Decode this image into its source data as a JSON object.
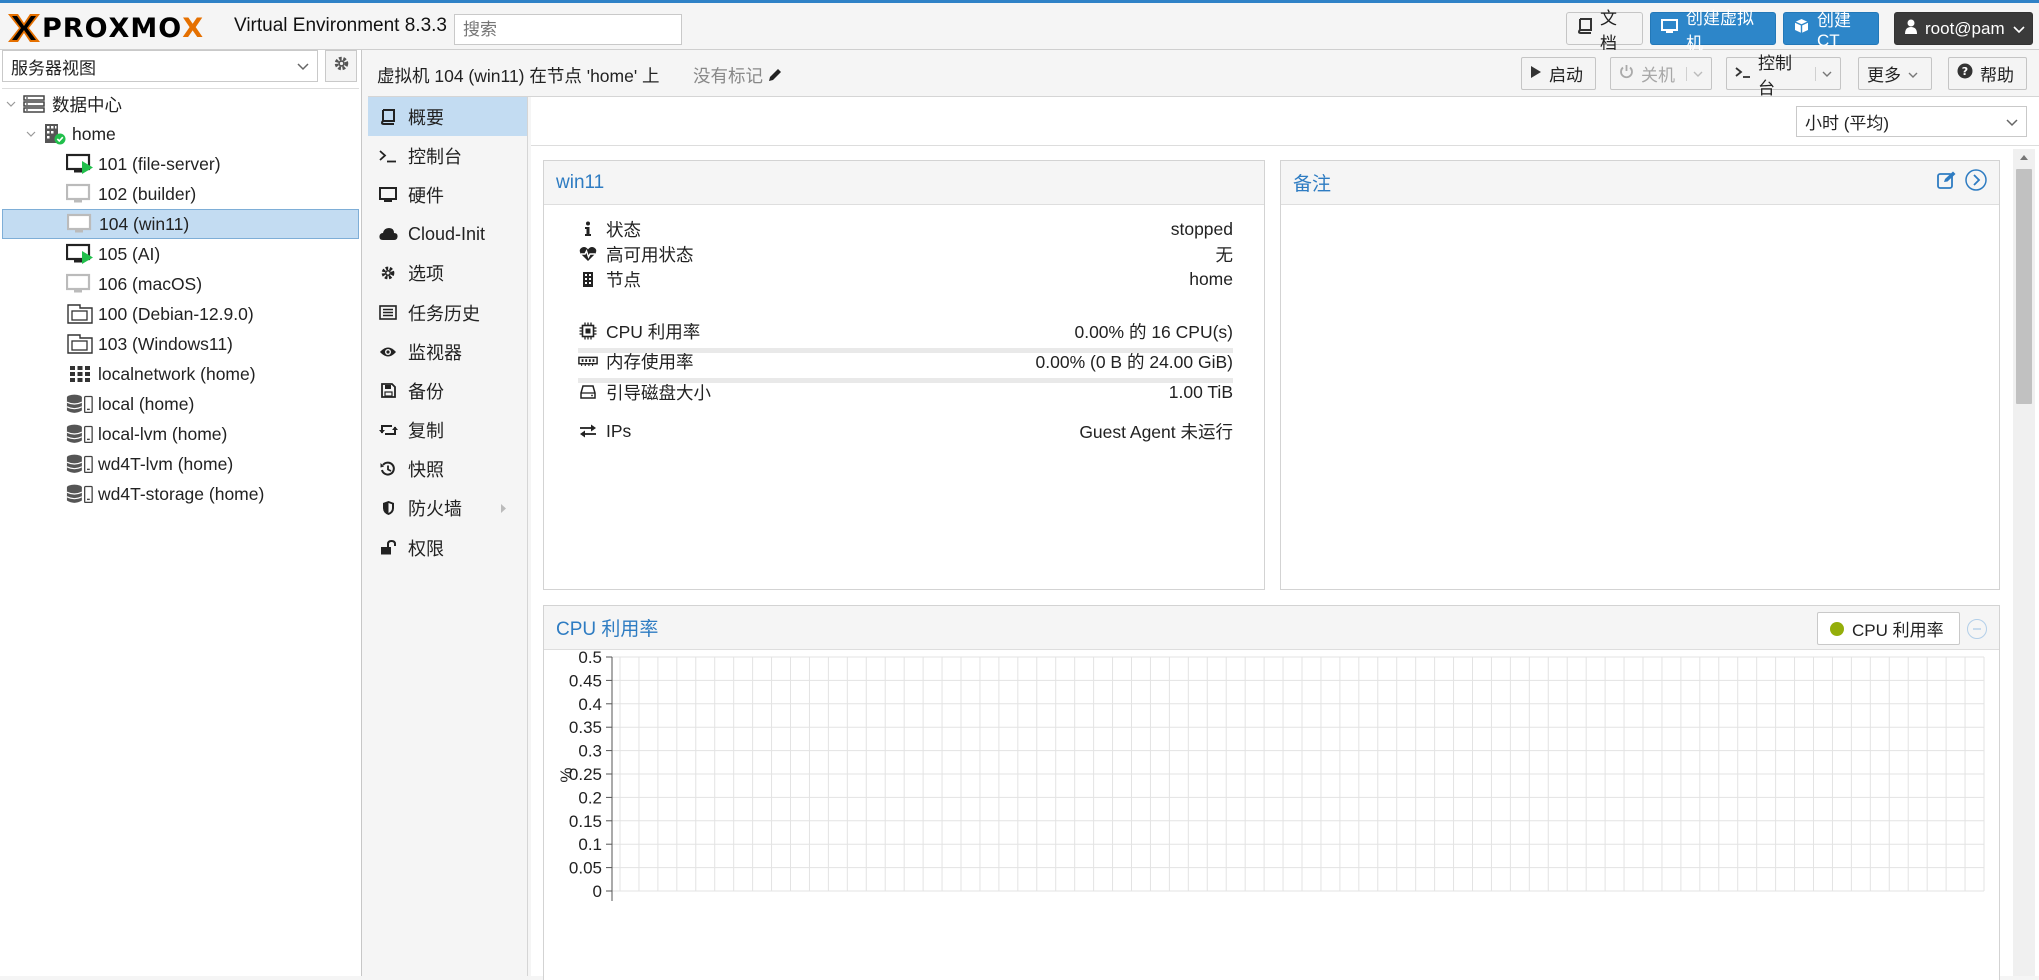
{
  "topbar": {
    "logo_text_left": "PRO",
    "logo_text_right": "MO",
    "logo_x": "X",
    "title": "Virtual Environment 8.3.3",
    "search_placeholder": "搜索",
    "docs_label": "文档",
    "create_vm_label": "创建虚拟机",
    "create_ct_label": "创建 CT",
    "user_label": "root@pam"
  },
  "sidebar": {
    "view_label": "服务器视图",
    "tree": [
      {
        "label": "数据中心",
        "icon": "datacenter-icon",
        "level": 0
      },
      {
        "label": "home",
        "icon": "node-online-icon",
        "level": 1
      },
      {
        "label": "101 (file-server)",
        "icon": "vm-running-icon",
        "level": 2
      },
      {
        "label": "102 (builder)",
        "icon": "vm-stopped-icon",
        "level": 2
      },
      {
        "label": "104 (win11)",
        "icon": "vm-stopped-icon",
        "level": 2,
        "selected": true
      },
      {
        "label": "105 (AI)",
        "icon": "vm-running-icon",
        "level": 2
      },
      {
        "label": "106 (macOS)",
        "icon": "vm-stopped-icon",
        "level": 2
      },
      {
        "label": "100 (Debian-12.9.0)",
        "icon": "vm-template-icon",
        "level": 2
      },
      {
        "label": "103 (Windows11)",
        "icon": "vm-template-icon",
        "level": 2
      },
      {
        "label": "localnetwork (home)",
        "icon": "sdn-grid-icon",
        "level": 2
      },
      {
        "label": "local (home)",
        "icon": "storage-icon",
        "level": 2
      },
      {
        "label": "local-lvm (home)",
        "icon": "storage-icon",
        "level": 2
      },
      {
        "label": "wd4T-lvm (home)",
        "icon": "storage-icon",
        "level": 2
      },
      {
        "label": "wd4T-storage (home)",
        "icon": "storage-icon",
        "level": 2
      }
    ]
  },
  "header": {
    "title": "虚拟机 104 (win11) 在节点 'home' 上",
    "tags": "没有标记",
    "start_label": "启动",
    "shutdown_label": "关机",
    "console_label": "控制台",
    "more_label": "更多",
    "help_label": "帮助"
  },
  "nav": [
    {
      "label": "概要",
      "icon": "book-icon",
      "active": true
    },
    {
      "label": "控制台",
      "icon": "terminal-icon"
    },
    {
      "label": "硬件",
      "icon": "monitor-icon"
    },
    {
      "label": "Cloud-Init",
      "icon": "cloud-icon"
    },
    {
      "label": "选项",
      "icon": "gear-icon"
    },
    {
      "label": "任务历史",
      "icon": "list-icon"
    },
    {
      "label": "监视器",
      "icon": "eye-icon"
    },
    {
      "label": "备份",
      "icon": "floppy-icon"
    },
    {
      "label": "复制",
      "icon": "retweet-icon"
    },
    {
      "label": "快照",
      "icon": "history-icon"
    },
    {
      "label": "防火墙",
      "icon": "shield-icon"
    },
    {
      "label": "权限",
      "icon": "unlock-icon"
    }
  ],
  "timeframe": "小时 (平均)",
  "summary": {
    "title": "win11",
    "rows": [
      {
        "label": "状态",
        "value": "stopped",
        "icon": "info-icon"
      },
      {
        "label": "高可用状态",
        "value": "无",
        "icon": "heartbeat-icon"
      },
      {
        "label": "节点",
        "value": "home",
        "icon": "building-icon"
      },
      {
        "label": "CPU 利用率",
        "value": "0.00% 的 16 CPU(s)",
        "icon": "cpu-icon"
      },
      {
        "label": "内存使用率",
        "value": "0.00% (0 B 的 24.00 GiB)",
        "icon": "memory-icon"
      },
      {
        "label": "引导磁盘大小",
        "value": "1.00 TiB",
        "icon": "hdd-icon"
      },
      {
        "label": "IPs",
        "value": "Guest Agent 未运行",
        "icon": "exchange-icon"
      }
    ]
  },
  "notes": {
    "title": "备注"
  },
  "cpu_chart": {
    "title": "CPU 利用率",
    "legend_label": "CPU 利用率",
    "legend_color": "#94ae0a",
    "accent": "#2e7cc2"
  },
  "chart_data": {
    "type": "line",
    "title": "CPU 利用率",
    "ylabel": "%",
    "ylim": [
      0,
      0.5
    ],
    "y_ticks": [
      "0.5",
      "0.45",
      "0.4",
      "0.35",
      "0.3",
      "0.25",
      "0.2",
      "0.15",
      "0.1",
      "0.05",
      "0"
    ],
    "series": [
      {
        "name": "CPU 利用率",
        "values": []
      }
    ],
    "grid": true
  }
}
